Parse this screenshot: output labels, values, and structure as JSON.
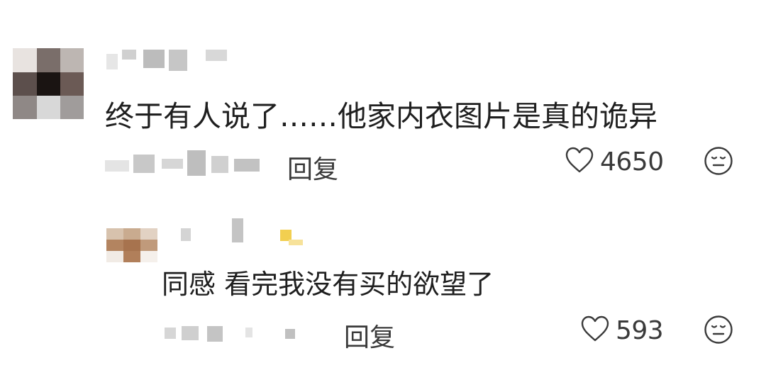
{
  "comments": [
    {
      "text": "终于有人说了……他家内衣图片是真的诡异",
      "reply_label": "回复",
      "likes": "4650",
      "like_icon": "heart-outline-icon",
      "reaction_icon": "neutral-face-icon"
    },
    {
      "text": "同感 看完我没有买的欲望了",
      "reply_label": "回复",
      "likes": "593",
      "like_icon": "heart-outline-icon",
      "reaction_icon": "neutral-face-icon"
    }
  ],
  "colors": {
    "text": "#1f1f1f",
    "meta": "#3a3a3a",
    "mosaic": "#dcdcdc",
    "background": "#ffffff"
  }
}
